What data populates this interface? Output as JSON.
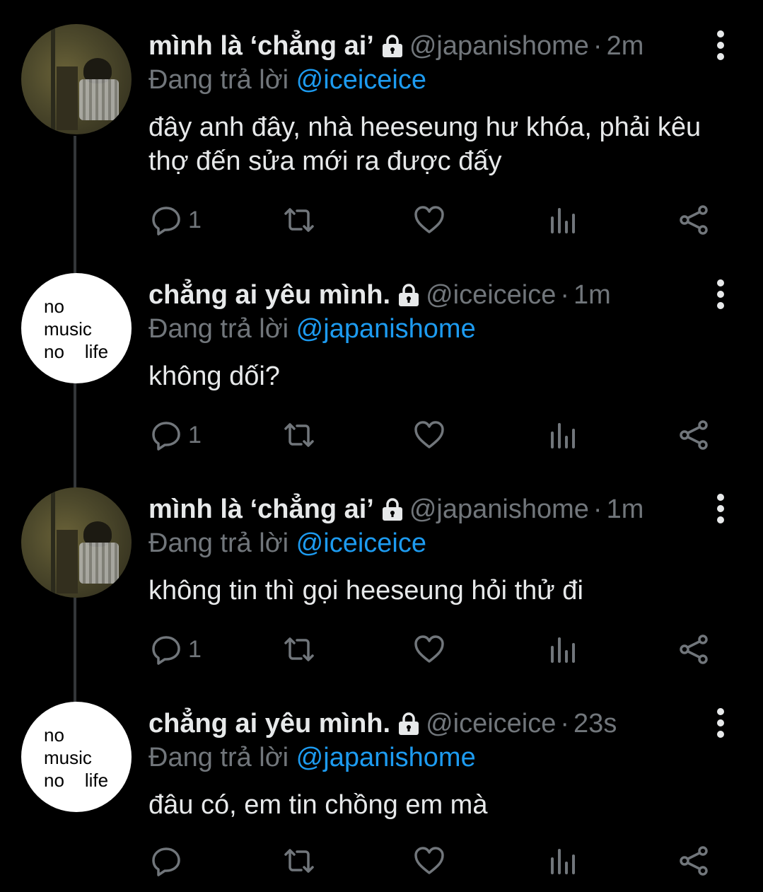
{
  "tweets": [
    {
      "display_name": "mình là ‘chẳng ai’",
      "handle": "@japanishome",
      "time": "2m",
      "reply_prefix": "Đang trả lời",
      "reply_to": "@iceiceice",
      "text": "đây anh đây, nhà heeseung hư khóa, phải kêu thợ đến sửa mới ra được đấy",
      "reply_count": "1",
      "avatar": "photo"
    },
    {
      "display_name": "chẳng ai yêu mình.",
      "handle": "@iceiceice",
      "time": "1m",
      "reply_prefix": "Đang trả lời",
      "reply_to": "@japanishome",
      "text": "không dối?",
      "reply_count": "1",
      "avatar": "text",
      "avatar_text": [
        "no",
        "music",
        "no    life"
      ]
    },
    {
      "display_name": "mình là ‘chẳng ai’",
      "handle": "@japanishome",
      "time": "1m",
      "reply_prefix": "Đang trả lời",
      "reply_to": "@iceiceice",
      "text": "không tin thì gọi heeseung hỏi thử đi",
      "reply_count": "1",
      "avatar": "photo"
    },
    {
      "display_name": "chẳng ai yêu mình.",
      "handle": "@iceiceice",
      "time": "23s",
      "reply_prefix": "Đang trả lời",
      "reply_to": "@japanishome",
      "text": "đâu có, em tin chồng em mà",
      "reply_count": "",
      "avatar": "text",
      "avatar_text": [
        "no",
        "music",
        "no    life"
      ]
    }
  ],
  "separator": "·",
  "icons": {
    "lock": "lock-icon",
    "more": "more-vertical-icon",
    "reply": "reply-icon",
    "retweet": "retweet-icon",
    "like": "heart-icon",
    "views": "views-icon",
    "share": "share-icon"
  },
  "colors": {
    "background": "#000000",
    "text": "#e7e9ea",
    "secondary": "#71767b",
    "mention": "#1d9bf0",
    "thread_line": "#333639"
  }
}
